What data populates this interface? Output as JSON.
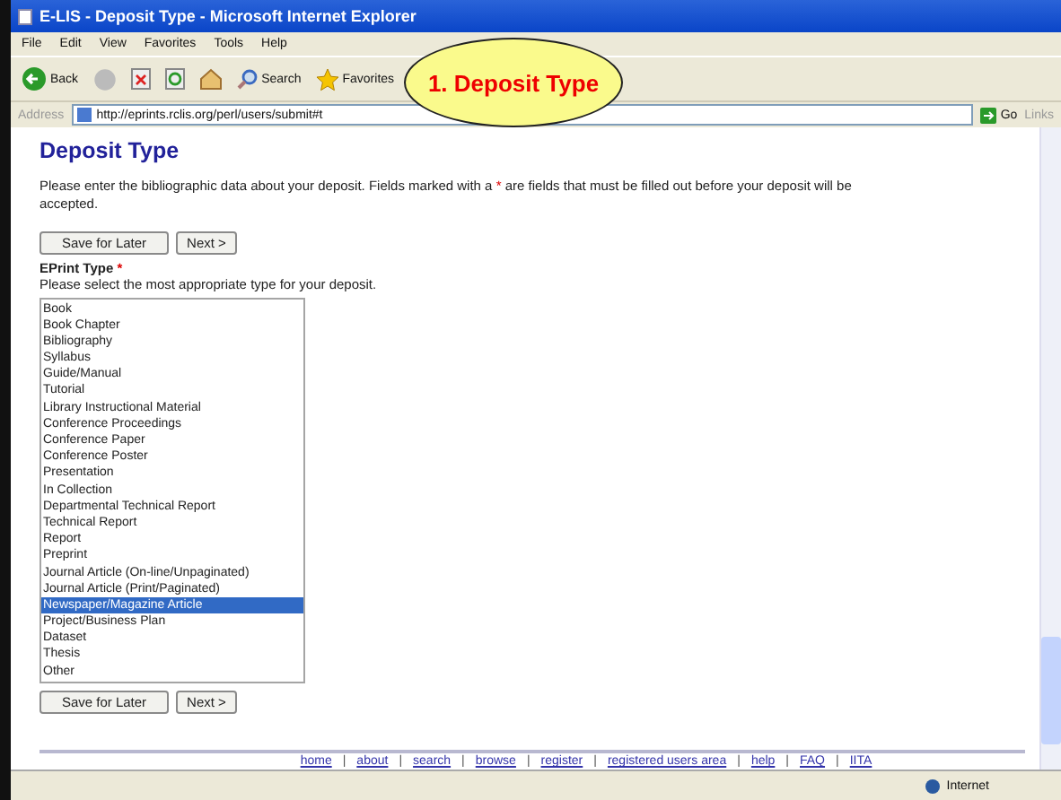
{
  "window": {
    "title": "E-LIS - Deposit Type - Microsoft Internet Explorer"
  },
  "menu": [
    "File",
    "Edit",
    "View",
    "Favorites",
    "Tools",
    "Help"
  ],
  "toolbar": {
    "back": "Back",
    "search": "Search",
    "favorites": "Favorites"
  },
  "address_bar": {
    "label": "Address",
    "url": "http://eprints.rclis.org/perl/users/submit#t",
    "go": "Go",
    "links": "Links"
  },
  "callout": "1. Deposit Type",
  "page": {
    "heading": "Deposit Type",
    "intro_before": "Please enter the bibliographic data about your deposit. Fields marked with a",
    "required_mark": "*",
    "intro_after": "are fields that must be filled out before your deposit will be accepted.",
    "buttons": [
      "Save for Later",
      "Next >"
    ],
    "field_label": "EPrint Type",
    "field_hint": "Please select the most appropriate type for your deposit.",
    "types": [
      {
        "label": "Book",
        "selected": false
      },
      {
        "label": "Book Chapter",
        "selected": false
      },
      {
        "label": "Bibliography",
        "selected": false
      },
      {
        "label": "Syllabus",
        "selected": false
      },
      {
        "label": "Guide/Manual",
        "selected": false
      },
      {
        "label": "Tutorial",
        "selected": false
      },
      {
        "label": "Library Instructional Material",
        "selected": false
      },
      {
        "label": "Conference Proceedings",
        "selected": false
      },
      {
        "label": "Conference Paper",
        "selected": false
      },
      {
        "label": "Conference Poster",
        "selected": false
      },
      {
        "label": "Presentation",
        "selected": false
      },
      {
        "label": "In Collection",
        "selected": false
      },
      {
        "label": "Departmental Technical Report",
        "selected": false
      },
      {
        "label": "Technical Report",
        "selected": false
      },
      {
        "label": "Report",
        "selected": false
      },
      {
        "label": "Preprint",
        "selected": false
      },
      {
        "label": "Journal Article (On-line/Unpaginated)",
        "selected": false
      },
      {
        "label": "Journal Article (Print/Paginated)",
        "selected": false
      },
      {
        "label": "Newspaper/Magazine Article",
        "selected": true
      },
      {
        "label": "Project/Business Plan",
        "selected": false
      },
      {
        "label": "Dataset",
        "selected": false
      },
      {
        "label": "Thesis",
        "selected": false
      },
      {
        "label": "Other",
        "selected": false
      }
    ],
    "bottom_buttons": [
      "Save for Later",
      "Next >"
    ],
    "footer_links": [
      "home",
      "about",
      "search",
      "browse",
      "register",
      "registered users area",
      "help",
      "FAQ",
      "IITA"
    ],
    "footer_separator": "|"
  },
  "status_bar": {
    "zone": "Internet"
  }
}
